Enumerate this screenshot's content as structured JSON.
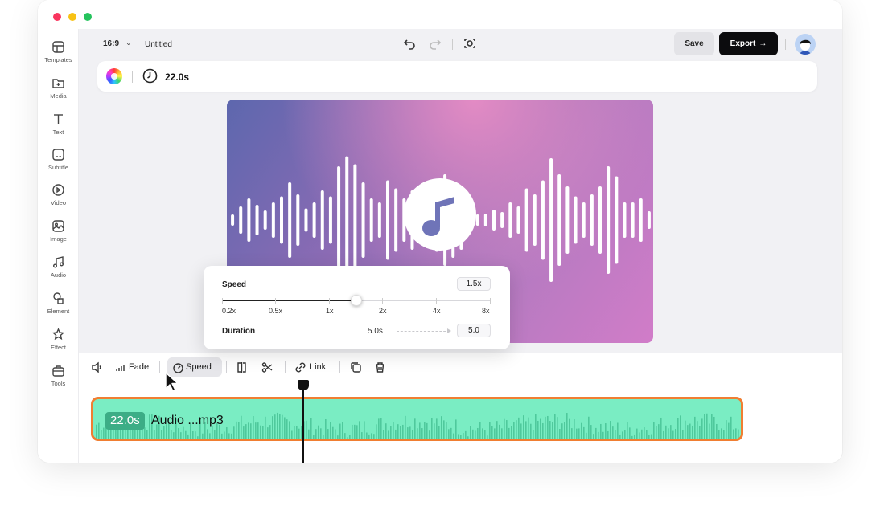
{
  "window": {
    "controls": [
      "close",
      "minimize",
      "zoom"
    ]
  },
  "sidebar": {
    "items": [
      {
        "label": "Templates",
        "icon": "templates-icon"
      },
      {
        "label": "Media",
        "icon": "media-icon"
      },
      {
        "label": "Text",
        "icon": "text-icon"
      },
      {
        "label": "Subtitle",
        "icon": "subtitle-icon"
      },
      {
        "label": "Video",
        "icon": "video-icon"
      },
      {
        "label": "Image",
        "icon": "image-icon"
      },
      {
        "label": "Audio",
        "icon": "audio-icon"
      },
      {
        "label": "Element",
        "icon": "element-icon"
      },
      {
        "label": "Effect",
        "icon": "effect-icon"
      },
      {
        "label": "Tools",
        "icon": "tools-icon"
      }
    ]
  },
  "topbar": {
    "aspect_ratio": "16:9",
    "doc_title": "Untitled",
    "save_label": "Save",
    "export_label": "Export"
  },
  "propbar": {
    "duration": "22.0s"
  },
  "speed_popup": {
    "speed_label": "Speed",
    "speed_value": "1.5x",
    "speed_fraction": 0.5,
    "ticks": [
      "0.2x",
      "0.5x",
      "1x",
      "2x",
      "4x",
      "8x"
    ],
    "duration_label": "Duration",
    "duration_from": "5.0s",
    "duration_to": "5.0"
  },
  "timeline": {
    "toolbar": {
      "fade_label": "Fade",
      "speed_label": "Speed",
      "link_label": "Link"
    },
    "clip": {
      "duration_badge": "22.0s",
      "name": "Audio ...mp3"
    }
  },
  "colors": {
    "clip_fill": "#7aedc3",
    "clip_border": "#f07e32",
    "export_bg": "#0c0c0e"
  }
}
